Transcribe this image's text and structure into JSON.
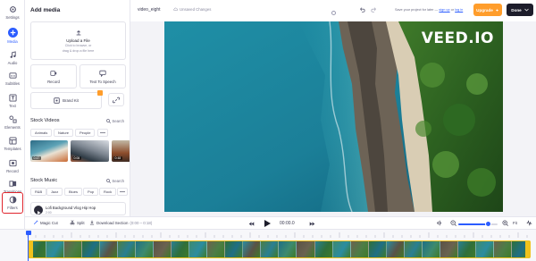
{
  "colors": {
    "accent": "#2b5cff",
    "upgrade": "#ff9d2b",
    "done": "#1d1d2b",
    "highlight": "#e0242c",
    "clip_border": "#f0c21c"
  },
  "rail": {
    "items": [
      {
        "label": "Settings",
        "icon": "gear-icon"
      },
      {
        "label": "Media",
        "icon": "plus-icon",
        "active": true
      },
      {
        "label": "Audio",
        "icon": "music-note-icon"
      },
      {
        "label": "Subtitles",
        "icon": "subtitles-icon"
      },
      {
        "label": "Text",
        "icon": "text-icon"
      },
      {
        "label": "Elements",
        "icon": "elements-icon"
      },
      {
        "label": "Templates",
        "icon": "templates-icon"
      },
      {
        "label": "Record",
        "icon": "record-icon"
      },
      {
        "label": "Transitions",
        "icon": "transitions-icon"
      },
      {
        "label": "Filters",
        "icon": "filters-icon"
      }
    ]
  },
  "panel": {
    "title": "Add media",
    "upload": {
      "title": "Upload a File",
      "hint1": "Click to browse, or",
      "hint2": "drag & drop a file here"
    },
    "tiles": {
      "record": "Record",
      "tts": "Text To Speech",
      "brand_kit": "Brand Kit"
    },
    "stock_videos": {
      "title": "Stock Videos",
      "search": "Search",
      "chips": [
        "Animals",
        "Nature",
        "People"
      ],
      "durations": [
        "0:47",
        "0:08",
        "0:48"
      ]
    },
    "stock_music": {
      "title": "Stock Music",
      "search": "Search",
      "chips": [
        "R&B",
        "Jazz",
        "Blues",
        "Pop",
        "Rock"
      ],
      "track_title": "Lofi Background Vlog Hip Hop",
      "track_duration": "2:00"
    }
  },
  "topbar": {
    "project_name": "video_eight",
    "unsaved": "Unsaved Changes",
    "save_note_prefix": "Save your project for later —",
    "sign_up": "sign up",
    "or": "or",
    "log_in": "log in",
    "upgrade": "Upgrade",
    "done": "Done"
  },
  "video": {
    "watermark": "VEED.IO"
  },
  "controls": {
    "magic_cut": "Magic Cut",
    "split": "Split",
    "download_section": "Download Section",
    "section_range": "(0:00 – 0:18)",
    "time": "00:00.0",
    "zoom_label": "Fit",
    "zoom_level": 0.75
  },
  "help": "?"
}
